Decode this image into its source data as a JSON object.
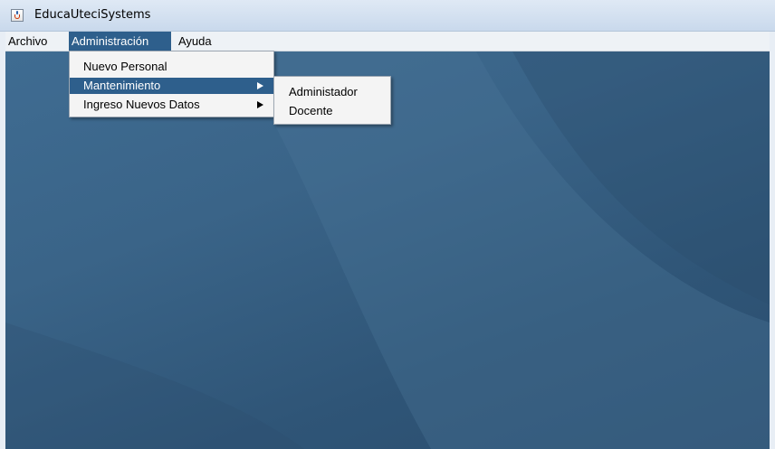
{
  "window": {
    "title": "EducaUteciSystems",
    "icon": "java-cup-icon"
  },
  "menubar": {
    "items": [
      {
        "label": "Archivo"
      },
      {
        "label": "Administración",
        "active": true
      },
      {
        "label": "Ayuda"
      }
    ]
  },
  "admin_menu": {
    "items": [
      {
        "label": "Nuevo Personal"
      },
      {
        "label": "Mantenimiento",
        "submenu": true,
        "selected": true
      },
      {
        "label": "Ingreso Nuevos Datos",
        "submenu": true
      }
    ]
  },
  "mantenimiento_submenu": {
    "items": [
      {
        "label": "Administador"
      },
      {
        "label": "Docente"
      }
    ]
  },
  "colors": {
    "selection": "#2e5f8c",
    "desktop": "#3a6488",
    "menu_background": "#f4f4f4"
  }
}
